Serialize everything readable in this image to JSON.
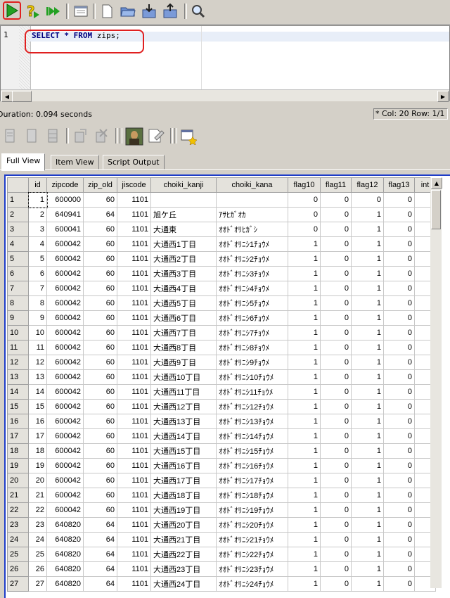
{
  "toolbar": {
    "buttons": [
      {
        "name": "execute-button",
        "icon": "play-icon"
      },
      {
        "name": "explain-button",
        "icon": "help-icon"
      },
      {
        "name": "execute-all-button",
        "icon": "fast-forward-icon"
      },
      {
        "name": "window-button",
        "icon": "window-icon"
      },
      {
        "name": "new-button",
        "icon": "new-file-icon"
      },
      {
        "name": "open-button",
        "icon": "folder-icon"
      },
      {
        "name": "load-button",
        "icon": "load-icon"
      },
      {
        "name": "save-button",
        "icon": "save-icon"
      },
      {
        "name": "find-button",
        "icon": "magnifier-icon"
      }
    ]
  },
  "editor": {
    "line_number": "1",
    "sql_keyword_1": "SELECT",
    "sql_star": " * ",
    "sql_keyword_2": "FROM",
    "sql_table": " zips;"
  },
  "status": {
    "duration": "Duration: 0.094 seconds",
    "cursor": "Col: 20 Row: 1/1"
  },
  "tabs": [
    "Full View",
    "Item View",
    "Script Output"
  ],
  "grid": {
    "columns": [
      "id",
      "zipcode",
      "zip_old",
      "jiscode",
      "choiki_kanji",
      "choiki_kana",
      "flag10",
      "flag11",
      "flag12",
      "flag13",
      "int"
    ],
    "rows": [
      [
        "1",
        "1",
        "600000",
        "60",
        "1101",
        "",
        "",
        "0",
        "0",
        "0",
        "0"
      ],
      [
        "2",
        "2",
        "640941",
        "64",
        "1101",
        "旭ケ丘",
        "ｱｻﾋｶﾞｵｶ",
        "0",
        "0",
        "1",
        "0"
      ],
      [
        "3",
        "3",
        "600041",
        "60",
        "1101",
        "大通東",
        "ｵｵﾄﾞｵﾘﾋｶﾞｼ",
        "0",
        "0",
        "1",
        "0"
      ],
      [
        "4",
        "4",
        "600042",
        "60",
        "1101",
        "大通西1丁目",
        "ｵｵﾄﾞｵﾘﾆｼ1ﾁｮｳﾒ",
        "1",
        "0",
        "1",
        "0"
      ],
      [
        "5",
        "5",
        "600042",
        "60",
        "1101",
        "大通西2丁目",
        "ｵｵﾄﾞｵﾘﾆｼ2ﾁｮｳﾒ",
        "1",
        "0",
        "1",
        "0"
      ],
      [
        "6",
        "6",
        "600042",
        "60",
        "1101",
        "大通西3丁目",
        "ｵｵﾄﾞｵﾘﾆｼ3ﾁｮｳﾒ",
        "1",
        "0",
        "1",
        "0"
      ],
      [
        "7",
        "7",
        "600042",
        "60",
        "1101",
        "大通西4丁目",
        "ｵｵﾄﾞｵﾘﾆｼ4ﾁｮｳﾒ",
        "1",
        "0",
        "1",
        "0"
      ],
      [
        "8",
        "8",
        "600042",
        "60",
        "1101",
        "大通西5丁目",
        "ｵｵﾄﾞｵﾘﾆｼ5ﾁｮｳﾒ",
        "1",
        "0",
        "1",
        "0"
      ],
      [
        "9",
        "9",
        "600042",
        "60",
        "1101",
        "大通西6丁目",
        "ｵｵﾄﾞｵﾘﾆｼ6ﾁｮｳﾒ",
        "1",
        "0",
        "1",
        "0"
      ],
      [
        "10",
        "10",
        "600042",
        "60",
        "1101",
        "大通西7丁目",
        "ｵｵﾄﾞｵﾘﾆｼ7ﾁｮｳﾒ",
        "1",
        "0",
        "1",
        "0"
      ],
      [
        "11",
        "11",
        "600042",
        "60",
        "1101",
        "大通西8丁目",
        "ｵｵﾄﾞｵﾘﾆｼ8ﾁｮｳﾒ",
        "1",
        "0",
        "1",
        "0"
      ],
      [
        "12",
        "12",
        "600042",
        "60",
        "1101",
        "大通西9丁目",
        "ｵｵﾄﾞｵﾘﾆｼ9ﾁｮｳﾒ",
        "1",
        "0",
        "1",
        "0"
      ],
      [
        "13",
        "13",
        "600042",
        "60",
        "1101",
        "大通西10丁目",
        "ｵｵﾄﾞｵﾘﾆｼ10ﾁｮｳﾒ",
        "1",
        "0",
        "1",
        "0"
      ],
      [
        "14",
        "14",
        "600042",
        "60",
        "1101",
        "大通西11丁目",
        "ｵｵﾄﾞｵﾘﾆｼ11ﾁｮｳﾒ",
        "1",
        "0",
        "1",
        "0"
      ],
      [
        "15",
        "15",
        "600042",
        "60",
        "1101",
        "大通西12丁目",
        "ｵｵﾄﾞｵﾘﾆｼ12ﾁｮｳﾒ",
        "1",
        "0",
        "1",
        "0"
      ],
      [
        "16",
        "16",
        "600042",
        "60",
        "1101",
        "大通西13丁目",
        "ｵｵﾄﾞｵﾘﾆｼ13ﾁｮｳﾒ",
        "1",
        "0",
        "1",
        "0"
      ],
      [
        "17",
        "17",
        "600042",
        "60",
        "1101",
        "大通西14丁目",
        "ｵｵﾄﾞｵﾘﾆｼ14ﾁｮｳﾒ",
        "1",
        "0",
        "1",
        "0"
      ],
      [
        "18",
        "18",
        "600042",
        "60",
        "1101",
        "大通西15丁目",
        "ｵｵﾄﾞｵﾘﾆｼ15ﾁｮｳﾒ",
        "1",
        "0",
        "1",
        "0"
      ],
      [
        "19",
        "19",
        "600042",
        "60",
        "1101",
        "大通西16丁目",
        "ｵｵﾄﾞｵﾘﾆｼ16ﾁｮｳﾒ",
        "1",
        "0",
        "1",
        "0"
      ],
      [
        "20",
        "20",
        "600042",
        "60",
        "1101",
        "大通西17丁目",
        "ｵｵﾄﾞｵﾘﾆｼ17ﾁｮｳﾒ",
        "1",
        "0",
        "1",
        "0"
      ],
      [
        "21",
        "21",
        "600042",
        "60",
        "1101",
        "大通西18丁目",
        "ｵｵﾄﾞｵﾘﾆｼ18ﾁｮｳﾒ",
        "1",
        "0",
        "1",
        "0"
      ],
      [
        "22",
        "22",
        "600042",
        "60",
        "1101",
        "大通西19丁目",
        "ｵｵﾄﾞｵﾘﾆｼ19ﾁｮｳﾒ",
        "1",
        "0",
        "1",
        "0"
      ],
      [
        "23",
        "23",
        "640820",
        "64",
        "1101",
        "大通西20丁目",
        "ｵｵﾄﾞｵﾘﾆｼ20ﾁｮｳﾒ",
        "1",
        "0",
        "1",
        "0"
      ],
      [
        "24",
        "24",
        "640820",
        "64",
        "1101",
        "大通西21丁目",
        "ｵｵﾄﾞｵﾘﾆｼ21ﾁｮｳﾒ",
        "1",
        "0",
        "1",
        "0"
      ],
      [
        "25",
        "25",
        "640820",
        "64",
        "1101",
        "大通西22丁目",
        "ｵｵﾄﾞｵﾘﾆｼ22ﾁｮｳﾒ",
        "1",
        "0",
        "1",
        "0"
      ],
      [
        "26",
        "26",
        "640820",
        "64",
        "1101",
        "大通西23丁目",
        "ｵｵﾄﾞｵﾘﾆｼ23ﾁｮｳﾒ",
        "1",
        "0",
        "1",
        "0"
      ],
      [
        "27",
        "27",
        "640820",
        "64",
        "1101",
        "大通西24丁目",
        "ｵｵﾄﾞｵﾘﾆｼ24ﾁｮｳﾒ",
        "1",
        "0",
        "1",
        "0"
      ]
    ]
  },
  "colors": {
    "highlight_red": "#e02020",
    "grid_border_blue": "#1e3cc8",
    "keyword_navy": "#000080"
  }
}
